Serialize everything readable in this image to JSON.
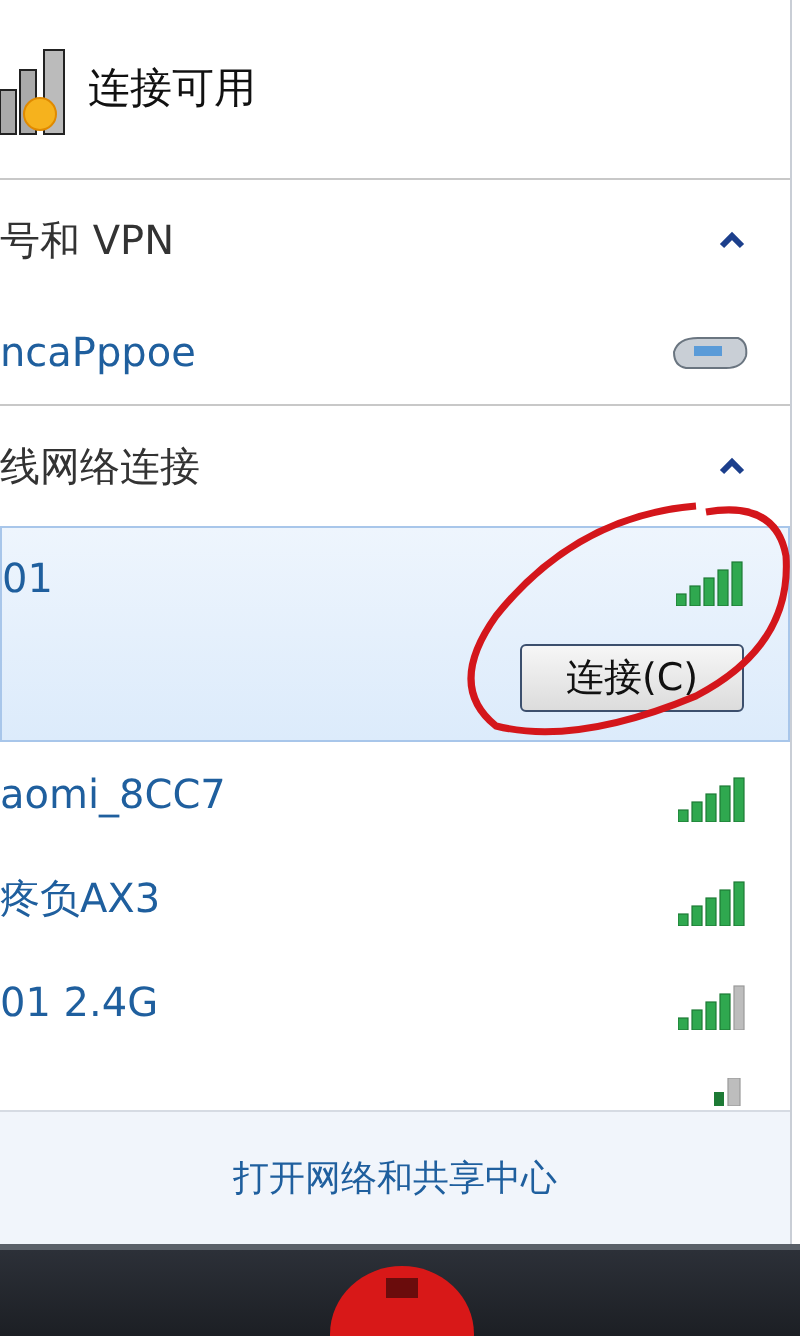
{
  "status": {
    "label": "连接可用"
  },
  "sections": [
    {
      "title": "号和 VPN",
      "expanded": true,
      "items": [
        {
          "kind": "dialup",
          "name": "ncaPppoe"
        }
      ]
    },
    {
      "title": "线网络连接",
      "expanded": true,
      "items": [
        {
          "kind": "strong",
          "name": "01",
          "selected": true,
          "button": "连接(C)"
        },
        {
          "kind": "strong",
          "name": "aomi_8CC7",
          "selected": false
        },
        {
          "kind": "strong",
          "name": "疼负AX3",
          "selected": false
        },
        {
          "kind": "fair",
          "name": "01 2.4G",
          "selected": false
        },
        {
          "kind": "weak",
          "selected": false
        }
      ]
    }
  ],
  "footer_link": "打开网络和共享中心"
}
